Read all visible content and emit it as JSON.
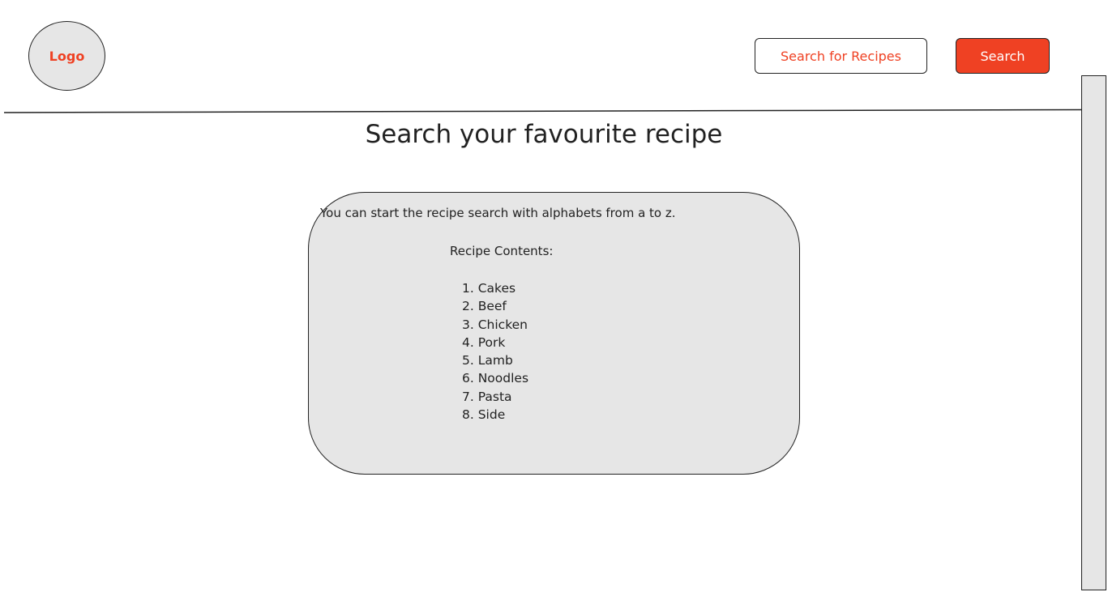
{
  "header": {
    "logo_text": "Logo",
    "search_placeholder": "Search for Recipes",
    "search_button_label": "Search"
  },
  "main": {
    "title": "Search your favourite recipe",
    "intro_text": "You can start the recipe search with alphabets from a to z.",
    "contents_heading": "Recipe Contents:",
    "recipes": [
      "1. Cakes",
      "2. Beef",
      "3. Chicken",
      "4. Pork",
      "5. Lamb",
      "6. Noodles",
      "7. Pasta",
      "8. Side"
    ]
  },
  "colors": {
    "accent": "#ef4123",
    "card_background": "#e6e6e6",
    "border": "#222222"
  }
}
